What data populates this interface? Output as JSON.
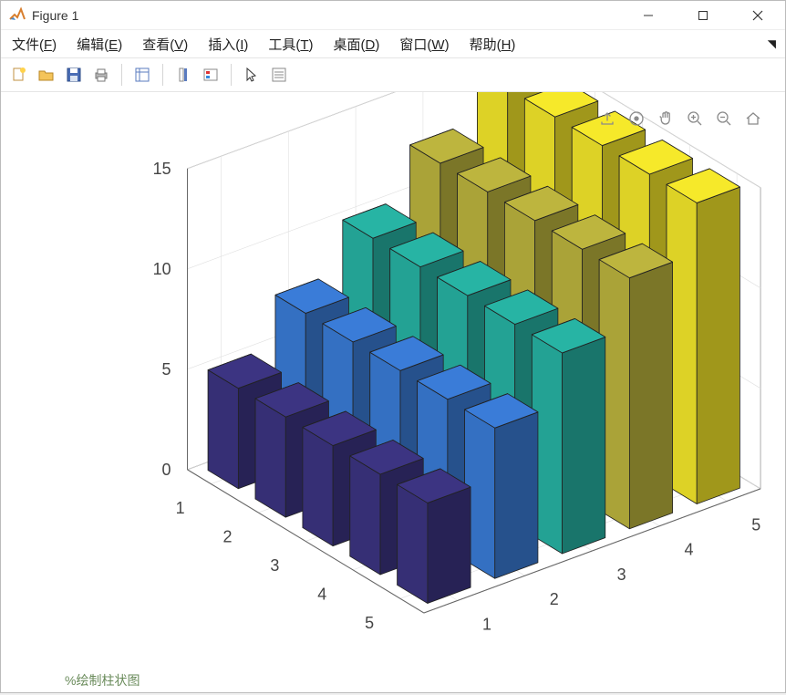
{
  "window": {
    "title": "Figure 1"
  },
  "menu": {
    "file": "文件(F)",
    "edit": "编辑(E)",
    "view": "查看(V)",
    "insert": "插入(I)",
    "tools": "工具(T)",
    "desktop": "桌面(D)",
    "window": "窗口(W)",
    "help": "帮助(H)"
  },
  "partial": "%绘制柱状图",
  "chart_data": {
    "type": "bar",
    "title": "",
    "xlabel": "",
    "ylabel": "",
    "zlabel": "",
    "x_categories": [
      1,
      2,
      3,
      4,
      5
    ],
    "y_categories": [
      1,
      2,
      3,
      4,
      5
    ],
    "z_ticks": [
      0,
      5,
      10,
      15
    ],
    "zlim": [
      0,
      15
    ],
    "series": [
      {
        "y": 1,
        "color": "#3c3482",
        "values": [
          5,
          5,
          5,
          5,
          5
        ]
      },
      {
        "y": 2,
        "color": "#3a7cd8",
        "values": [
          7.5,
          7.5,
          7.5,
          7.5,
          7.5
        ]
      },
      {
        "y": 3,
        "color": "#27b4a4",
        "values": [
          10,
          10,
          10,
          10,
          10
        ]
      },
      {
        "y": 4,
        "color": "#bdb53e",
        "values": [
          12.5,
          12.5,
          12.5,
          12.5,
          12.5
        ]
      },
      {
        "y": 5,
        "color": "#f6e92a",
        "values": [
          15,
          15,
          15,
          15,
          15
        ]
      }
    ]
  }
}
